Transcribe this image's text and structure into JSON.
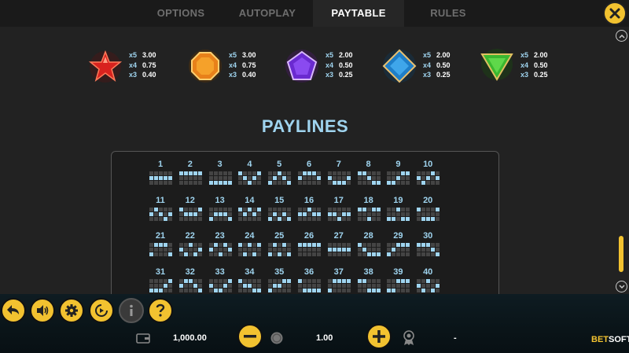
{
  "tabs": [
    {
      "label": "OPTIONS",
      "active": false
    },
    {
      "label": "AUTOPLAY",
      "active": false
    },
    {
      "label": "PAYTABLE",
      "active": true
    },
    {
      "label": "RULES",
      "active": false
    }
  ],
  "symbols": [
    {
      "icon": "red-star-gem-icon",
      "pays": [
        {
          "mult": "x5",
          "value": "3.00"
        },
        {
          "mult": "x4",
          "value": "0.75"
        },
        {
          "mult": "x3",
          "value": "0.40"
        }
      ]
    },
    {
      "icon": "orange-octagon-gem-icon",
      "pays": [
        {
          "mult": "x5",
          "value": "3.00"
        },
        {
          "mult": "x4",
          "value": "0.75"
        },
        {
          "mult": "x3",
          "value": "0.40"
        }
      ]
    },
    {
      "icon": "purple-pentagon-gem-icon",
      "pays": [
        {
          "mult": "x5",
          "value": "2.00"
        },
        {
          "mult": "x4",
          "value": "0.50"
        },
        {
          "mult": "x3",
          "value": "0.25"
        }
      ]
    },
    {
      "icon": "blue-diamond-gem-icon",
      "pays": [
        {
          "mult": "x5",
          "value": "2.00"
        },
        {
          "mult": "x4",
          "value": "0.50"
        },
        {
          "mult": "x3",
          "value": "0.25"
        }
      ]
    },
    {
      "icon": "green-triangle-gem-icon",
      "pays": [
        {
          "mult": "x5",
          "value": "2.00"
        },
        {
          "mult": "x4",
          "value": "0.50"
        },
        {
          "mult": "x3",
          "value": "0.25"
        }
      ]
    }
  ],
  "paylines_title": "PAYLINES",
  "paylines": [
    {
      "n": "1",
      "rows": [
        1,
        1,
        1,
        1,
        1
      ]
    },
    {
      "n": "2",
      "rows": [
        0,
        0,
        0,
        0,
        0
      ]
    },
    {
      "n": "3",
      "rows": [
        2,
        2,
        2,
        2,
        2
      ]
    },
    {
      "n": "4",
      "rows": [
        0,
        1,
        2,
        1,
        0
      ]
    },
    {
      "n": "5",
      "rows": [
        2,
        1,
        0,
        1,
        2
      ]
    },
    {
      "n": "6",
      "rows": [
        1,
        0,
        0,
        0,
        1
      ]
    },
    {
      "n": "7",
      "rows": [
        1,
        2,
        2,
        2,
        1
      ]
    },
    {
      "n": "8",
      "rows": [
        0,
        0,
        1,
        2,
        2
      ]
    },
    {
      "n": "9",
      "rows": [
        2,
        2,
        1,
        0,
        0
      ]
    },
    {
      "n": "10",
      "rows": [
        1,
        2,
        1,
        0,
        1
      ]
    },
    {
      "n": "11",
      "rows": [
        1,
        0,
        1,
        2,
        1
      ]
    },
    {
      "n": "12",
      "rows": [
        0,
        1,
        1,
        1,
        0
      ]
    },
    {
      "n": "13",
      "rows": [
        2,
        1,
        1,
        1,
        2
      ]
    },
    {
      "n": "14",
      "rows": [
        0,
        1,
        0,
        1,
        0
      ]
    },
    {
      "n": "15",
      "rows": [
        2,
        1,
        2,
        1,
        2
      ]
    },
    {
      "n": "16",
      "rows": [
        1,
        1,
        0,
        1,
        1
      ]
    },
    {
      "n": "17",
      "rows": [
        1,
        1,
        2,
        1,
        1
      ]
    },
    {
      "n": "18",
      "rows": [
        0,
        0,
        2,
        0,
        0
      ]
    },
    {
      "n": "19",
      "rows": [
        2,
        2,
        0,
        2,
        2
      ]
    },
    {
      "n": "20",
      "rows": [
        0,
        2,
        2,
        2,
        0
      ]
    },
    {
      "n": "21",
      "rows": [
        2,
        0,
        0,
        0,
        2
      ]
    },
    {
      "n": "22",
      "rows": [
        1,
        2,
        0,
        2,
        1
      ]
    },
    {
      "n": "23",
      "rows": [
        1,
        0,
        2,
        0,
        1
      ]
    },
    {
      "n": "24",
      "rows": [
        0,
        2,
        0,
        2,
        0
      ]
    },
    {
      "n": "25",
      "rows": [
        2,
        0,
        2,
        0,
        2
      ]
    },
    {
      "n": "26",
      "rows": [
        0,
        0,
        0,
        0,
        0
      ]
    },
    {
      "n": "27",
      "rows": [
        1,
        1,
        1,
        1,
        1
      ]
    },
    {
      "n": "28",
      "rows": [
        0,
        1,
        2,
        2,
        2
      ]
    },
    {
      "n": "29",
      "rows": [
        2,
        1,
        0,
        0,
        0
      ]
    },
    {
      "n": "30",
      "rows": [
        0,
        0,
        0,
        1,
        2
      ]
    },
    {
      "n": "31",
      "rows": [
        2,
        2,
        2,
        1,
        0
      ]
    },
    {
      "n": "32",
      "rows": [
        1,
        0,
        0,
        1,
        2
      ]
    },
    {
      "n": "33",
      "rows": [
        1,
        2,
        2,
        1,
        0
      ]
    },
    {
      "n": "34",
      "rows": [
        0,
        1,
        1,
        2,
        2
      ]
    },
    {
      "n": "35",
      "rows": [
        2,
        1,
        1,
        0,
        0
      ]
    },
    {
      "n": "36",
      "rows": [
        0,
        2,
        2,
        2,
        2
      ]
    },
    {
      "n": "37",
      "rows": [
        2,
        0,
        0,
        0,
        0
      ]
    },
    {
      "n": "38",
      "rows": [
        0,
        0,
        2,
        2,
        2
      ]
    },
    {
      "n": "39",
      "rows": [
        2,
        2,
        0,
        0,
        0
      ]
    },
    {
      "n": "40",
      "rows": [
        1,
        2,
        0,
        2,
        1
      ]
    }
  ],
  "bottom": {
    "balance": "1,000.00",
    "bet": "1.00",
    "win": "-",
    "brand_part1": "BET",
    "brand_part2": "SOFT"
  },
  "colors": {
    "accent": "#f2c230",
    "paytext": "#9fd4ef",
    "background": "#222222"
  }
}
